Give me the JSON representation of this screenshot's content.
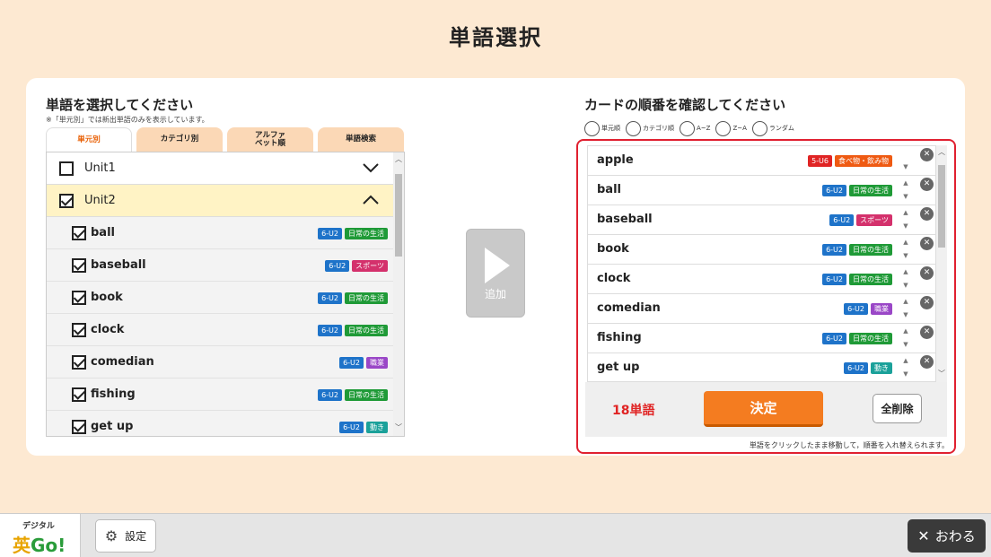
{
  "page_title": "単語選択",
  "left": {
    "title": "単語を選択してください",
    "note": "※「単元別」では新出単語のみを表示しています。",
    "tabs": [
      {
        "label": "単元別",
        "active": true
      },
      {
        "label": "カテゴリ別",
        "active": false
      },
      {
        "label": "アルファ\nベット順",
        "active": false
      },
      {
        "label": "単語検索",
        "active": false
      }
    ],
    "units": [
      {
        "label": "Unit1",
        "checked": false,
        "expanded": false
      },
      {
        "label": "Unit2",
        "checked": true,
        "expanded": true
      }
    ],
    "words": [
      {
        "word": "ball",
        "checked": true,
        "tags": [
          {
            "text": "6-U2",
            "color": "blue"
          },
          {
            "text": "日常の生活",
            "color": "green"
          }
        ]
      },
      {
        "word": "baseball",
        "checked": true,
        "tags": [
          {
            "text": "6-U2",
            "color": "blue"
          },
          {
            "text": "スポーツ",
            "color": "pink"
          }
        ]
      },
      {
        "word": "book",
        "checked": true,
        "tags": [
          {
            "text": "6-U2",
            "color": "blue"
          },
          {
            "text": "日常の生活",
            "color": "green"
          }
        ]
      },
      {
        "word": "clock",
        "checked": true,
        "tags": [
          {
            "text": "6-U2",
            "color": "blue"
          },
          {
            "text": "日常の生活",
            "color": "green"
          }
        ]
      },
      {
        "word": "comedian",
        "checked": true,
        "tags": [
          {
            "text": "6-U2",
            "color": "blue"
          },
          {
            "text": "職業",
            "color": "purple"
          }
        ]
      },
      {
        "word": "fishing",
        "checked": true,
        "tags": [
          {
            "text": "6-U2",
            "color": "blue"
          },
          {
            "text": "日常の生活",
            "color": "green"
          }
        ]
      },
      {
        "word": "get up",
        "checked": true,
        "tags": [
          {
            "text": "6-U2",
            "color": "blue"
          },
          {
            "text": "動き",
            "color": "teal"
          }
        ]
      }
    ]
  },
  "add_button": {
    "label": "追加"
  },
  "right": {
    "title": "カードの順番を確認してください",
    "sort_options": [
      "単元順",
      "カテゴリ順",
      "A~Z",
      "Z~A",
      "ランダム"
    ],
    "cards": [
      {
        "word": "apple",
        "tags": [
          {
            "text": "5-U6",
            "color": "red"
          },
          {
            "text": "食べ物・飲み物",
            "color": "orange"
          }
        ]
      },
      {
        "word": "ball",
        "tags": [
          {
            "text": "6-U2",
            "color": "blue"
          },
          {
            "text": "日常の生活",
            "color": "green"
          }
        ]
      },
      {
        "word": "baseball",
        "tags": [
          {
            "text": "6-U2",
            "color": "blue"
          },
          {
            "text": "スポーツ",
            "color": "pink"
          }
        ]
      },
      {
        "word": "book",
        "tags": [
          {
            "text": "6-U2",
            "color": "blue"
          },
          {
            "text": "日常の生活",
            "color": "green"
          }
        ]
      },
      {
        "word": "clock",
        "tags": [
          {
            "text": "6-U2",
            "color": "blue"
          },
          {
            "text": "日常の生活",
            "color": "green"
          }
        ]
      },
      {
        "word": "comedian",
        "tags": [
          {
            "text": "6-U2",
            "color": "blue"
          },
          {
            "text": "職業",
            "color": "purple"
          }
        ]
      },
      {
        "word": "fishing",
        "tags": [
          {
            "text": "6-U2",
            "color": "blue"
          },
          {
            "text": "日常の生活",
            "color": "green"
          }
        ]
      },
      {
        "word": "get up",
        "tags": [
          {
            "text": "6-U2",
            "color": "blue"
          },
          {
            "text": "動き",
            "color": "teal"
          }
        ]
      }
    ],
    "count": "18単語",
    "decide_label": "決定",
    "clear_label": "全削除",
    "hint": "単語をクリックしたまま移動して，順番を入れ替えられます。"
  },
  "bottom": {
    "logo_small": "デジタル",
    "logo_big": "英",
    "logo_go": "Go!",
    "settings_label": "設定",
    "close_label": "おわる"
  },
  "colors": {
    "accent": "#f47c20",
    "highlight": "#e02030",
    "background": "#fde9d2"
  }
}
